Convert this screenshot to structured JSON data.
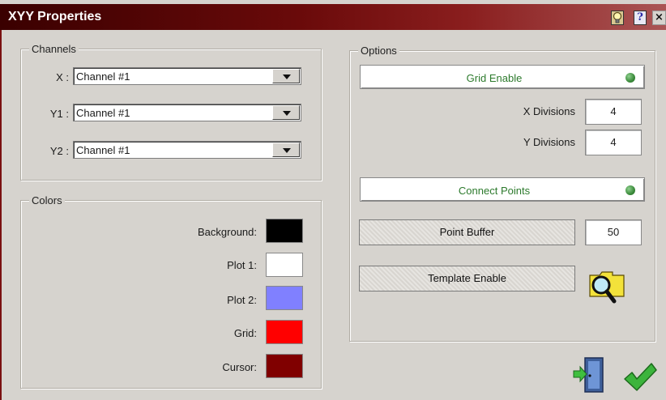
{
  "window": {
    "title": "XYY Properties"
  },
  "titlebar": {
    "hint_icon": "lightbulb-icon",
    "help_label": "?",
    "close_label": "×"
  },
  "channels": {
    "legend": "Channels",
    "rows": [
      {
        "label": "X :",
        "value": "Channel #1"
      },
      {
        "label": "Y1 :",
        "value": "Channel #1"
      },
      {
        "label": "Y2 :",
        "value": "Channel #1"
      }
    ]
  },
  "colors": {
    "legend": "Colors",
    "items": [
      {
        "label": "Background:",
        "color": "#000000"
      },
      {
        "label": "Plot 1:",
        "color": "#ffffff"
      },
      {
        "label": "Plot 2:",
        "color": "#8080ff"
      },
      {
        "label": "Grid:",
        "color": "#ff0000"
      },
      {
        "label": "Cursor:",
        "color": "#800000"
      }
    ]
  },
  "options": {
    "legend": "Options",
    "grid_enable": {
      "label": "Grid Enable",
      "on": true
    },
    "x_divisions": {
      "label": "X Divisions",
      "value": "4"
    },
    "y_divisions": {
      "label": "Y Divisions",
      "value": "4"
    },
    "connect_points": {
      "label": "Connect Points",
      "on": true
    },
    "point_buffer": {
      "label": "Point Buffer",
      "value": "50"
    },
    "template_enable": {
      "label": "Template Enable"
    },
    "browse_icon": "folder-search-icon"
  },
  "footer": {
    "cancel_icon": "exit-door-icon",
    "ok_icon": "checkmark-icon"
  },
  "accent_colors": {
    "titlebar": "#6a0a0a",
    "led": "#3a8a3a",
    "option_text": "#2c7a2c"
  }
}
